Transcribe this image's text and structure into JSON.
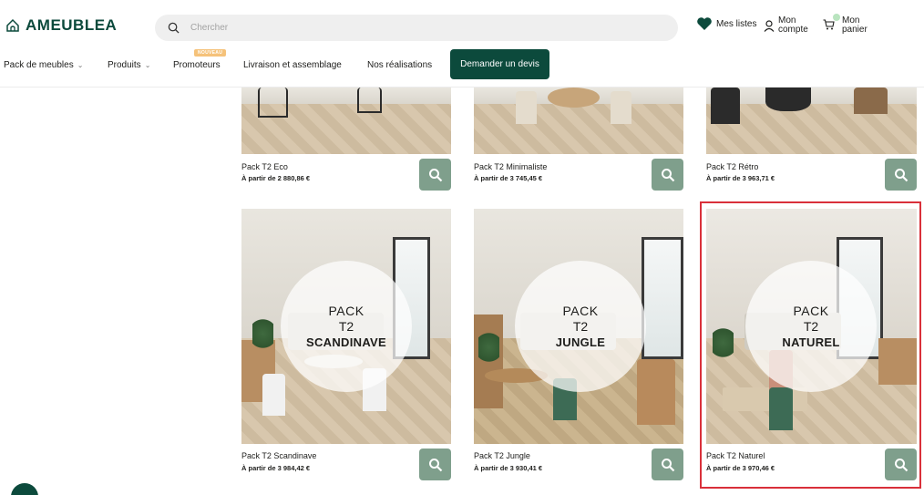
{
  "header": {
    "brand": "AMEUBLEA",
    "search_placeholder": "Chercher",
    "lists_label": "Mes listes",
    "account_line1": "Mon",
    "account_line2": "compte",
    "cart_line1": "Mon",
    "cart_line2": "panier"
  },
  "nav": {
    "items": [
      {
        "label": "Pack de meubles",
        "has_dropdown": true
      },
      {
        "label": "Produits",
        "has_dropdown": true
      },
      {
        "label": "Promoteurs",
        "has_dropdown": false
      },
      {
        "label": "Livraison et assemblage",
        "has_dropdown": false
      },
      {
        "label": "Nos réalisations",
        "has_dropdown": false
      }
    ],
    "new_badge": "NOUVEAU",
    "cta": "Demander un devis"
  },
  "products": [
    {
      "name": "Pack T2 Eco",
      "price": "À partir de 2 880,86 €"
    },
    {
      "name": "Pack T2 Minimaliste",
      "price": "À partir de 3 745,45 €"
    },
    {
      "name": "Pack T2 Rétro",
      "price": "À partir de 3 963,71 €"
    },
    {
      "name": "Pack T2 Scandinave",
      "price": "À partir de 3 984,42 €",
      "overlay": [
        "PACK",
        "T2",
        "SCANDINAVE"
      ]
    },
    {
      "name": "Pack T2 Jungle",
      "price": "À partir de 3 930,41 €",
      "overlay": [
        "PACK",
        "T2",
        "JUNGLE"
      ]
    },
    {
      "name": "Pack T2 Naturel",
      "price": "À partir de 3 970,46 €",
      "overlay": [
        "PACK",
        "T2",
        "NATUREL"
      ]
    }
  ],
  "colors": {
    "brand": "#0c4a3c",
    "zoom_button": "#7f9f8c",
    "highlight": "#d9303a",
    "badge": "#f5c27a"
  },
  "icons": {
    "logo": "house-icon",
    "search": "search-icon",
    "lists": "heart-icon",
    "account": "user-icon",
    "cart": "cart-icon",
    "zoom": "magnifier-icon"
  }
}
